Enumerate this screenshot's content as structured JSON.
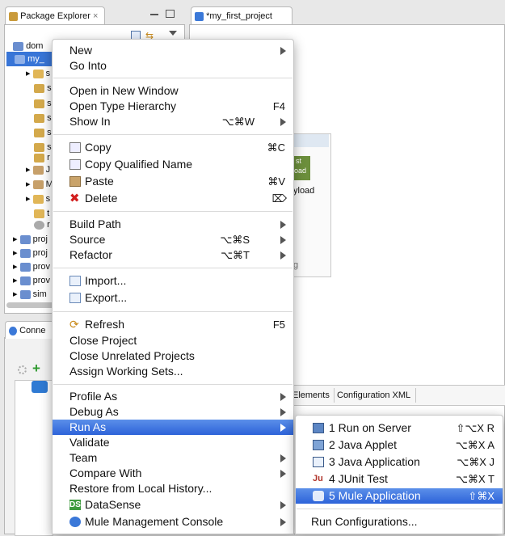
{
  "package_explorer": {
    "tab_title": "Package Explorer",
    "tree_items": [
      "dom",
      "my_",
      "s",
      "s",
      "s",
      "s",
      "s",
      "s",
      "r",
      "J",
      "M",
      "s",
      "t",
      "r",
      "proj",
      "proj",
      "prov",
      "prov",
      "sim"
    ]
  },
  "editor": {
    "tab_title": "*my_first_project",
    "canvas_texts": [
      "st",
      "load",
      "yload",
      "g"
    ],
    "tabs": [
      "Elements",
      "Configuration XML"
    ]
  },
  "connections_view": {
    "tab_title": "Conne"
  },
  "context_menu": {
    "items": [
      {
        "label": "New",
        "shortcut": "",
        "submenu": true
      },
      {
        "label": "Go Into",
        "shortcut": "",
        "submenu": false
      },
      {
        "label": "Open in New Window",
        "shortcut": "",
        "submenu": false
      },
      {
        "label": "Open Type Hierarchy",
        "shortcut": "F4",
        "submenu": false
      },
      {
        "label": "Show In",
        "shortcut": "⌥⌘W",
        "submenu": true
      },
      {
        "label": "Copy",
        "shortcut": "⌘C",
        "submenu": false,
        "icon": "copy-icon"
      },
      {
        "label": "Copy Qualified Name",
        "shortcut": "",
        "submenu": false,
        "icon": "copy-qualified-name-icon"
      },
      {
        "label": "Paste",
        "shortcut": "⌘V",
        "submenu": false,
        "icon": "paste-icon"
      },
      {
        "label": "Delete",
        "shortcut": "⌦",
        "submenu": false,
        "icon": "delete-icon"
      },
      {
        "label": "Build Path",
        "shortcut": "",
        "submenu": true
      },
      {
        "label": "Source",
        "shortcut": "⌥⌘S",
        "submenu": true
      },
      {
        "label": "Refactor",
        "shortcut": "⌥⌘T",
        "submenu": true
      },
      {
        "label": "Import...",
        "shortcut": "",
        "submenu": false,
        "icon": "import-icon"
      },
      {
        "label": "Export...",
        "shortcut": "",
        "submenu": false,
        "icon": "export-icon"
      },
      {
        "label": "Refresh",
        "shortcut": "F5",
        "submenu": false,
        "icon": "refresh-icon"
      },
      {
        "label": "Close Project",
        "shortcut": "",
        "submenu": false
      },
      {
        "label": "Close Unrelated Projects",
        "shortcut": "",
        "submenu": false
      },
      {
        "label": "Assign Working Sets...",
        "shortcut": "",
        "submenu": false
      },
      {
        "label": "Profile As",
        "shortcut": "",
        "submenu": true
      },
      {
        "label": "Debug As",
        "shortcut": "",
        "submenu": true
      },
      {
        "label": "Run As",
        "shortcut": "",
        "submenu": true
      },
      {
        "label": "Validate",
        "shortcut": "",
        "submenu": false
      },
      {
        "label": "Team",
        "shortcut": "",
        "submenu": true
      },
      {
        "label": "Compare With",
        "shortcut": "",
        "submenu": true
      },
      {
        "label": "Restore from Local History...",
        "shortcut": "",
        "submenu": false
      },
      {
        "label": "DataSense",
        "shortcut": "",
        "submenu": true,
        "icon": "datasense-icon"
      },
      {
        "label": "Mule Management Console",
        "shortcut": "",
        "submenu": true,
        "icon": "mule-console-icon"
      }
    ]
  },
  "run_as_submenu": {
    "items": [
      {
        "label": "1 Run on Server",
        "shortcut": "⇧⌥X R",
        "icon": "server-icon"
      },
      {
        "label": "2 Java Applet",
        "shortcut": "⌥⌘X A",
        "icon": "applet-icon"
      },
      {
        "label": "3 Java Application",
        "shortcut": "⌥⌘X J",
        "icon": "java-app-icon"
      },
      {
        "label": "4 JUnit Test",
        "shortcut": "⌥⌘X T",
        "icon": "junit-icon"
      },
      {
        "label": "5 Mule Application",
        "shortcut": "⇧⌘X",
        "icon": "mule-app-icon"
      },
      {
        "label": "Run Configurations...",
        "shortcut": ""
      }
    ]
  }
}
